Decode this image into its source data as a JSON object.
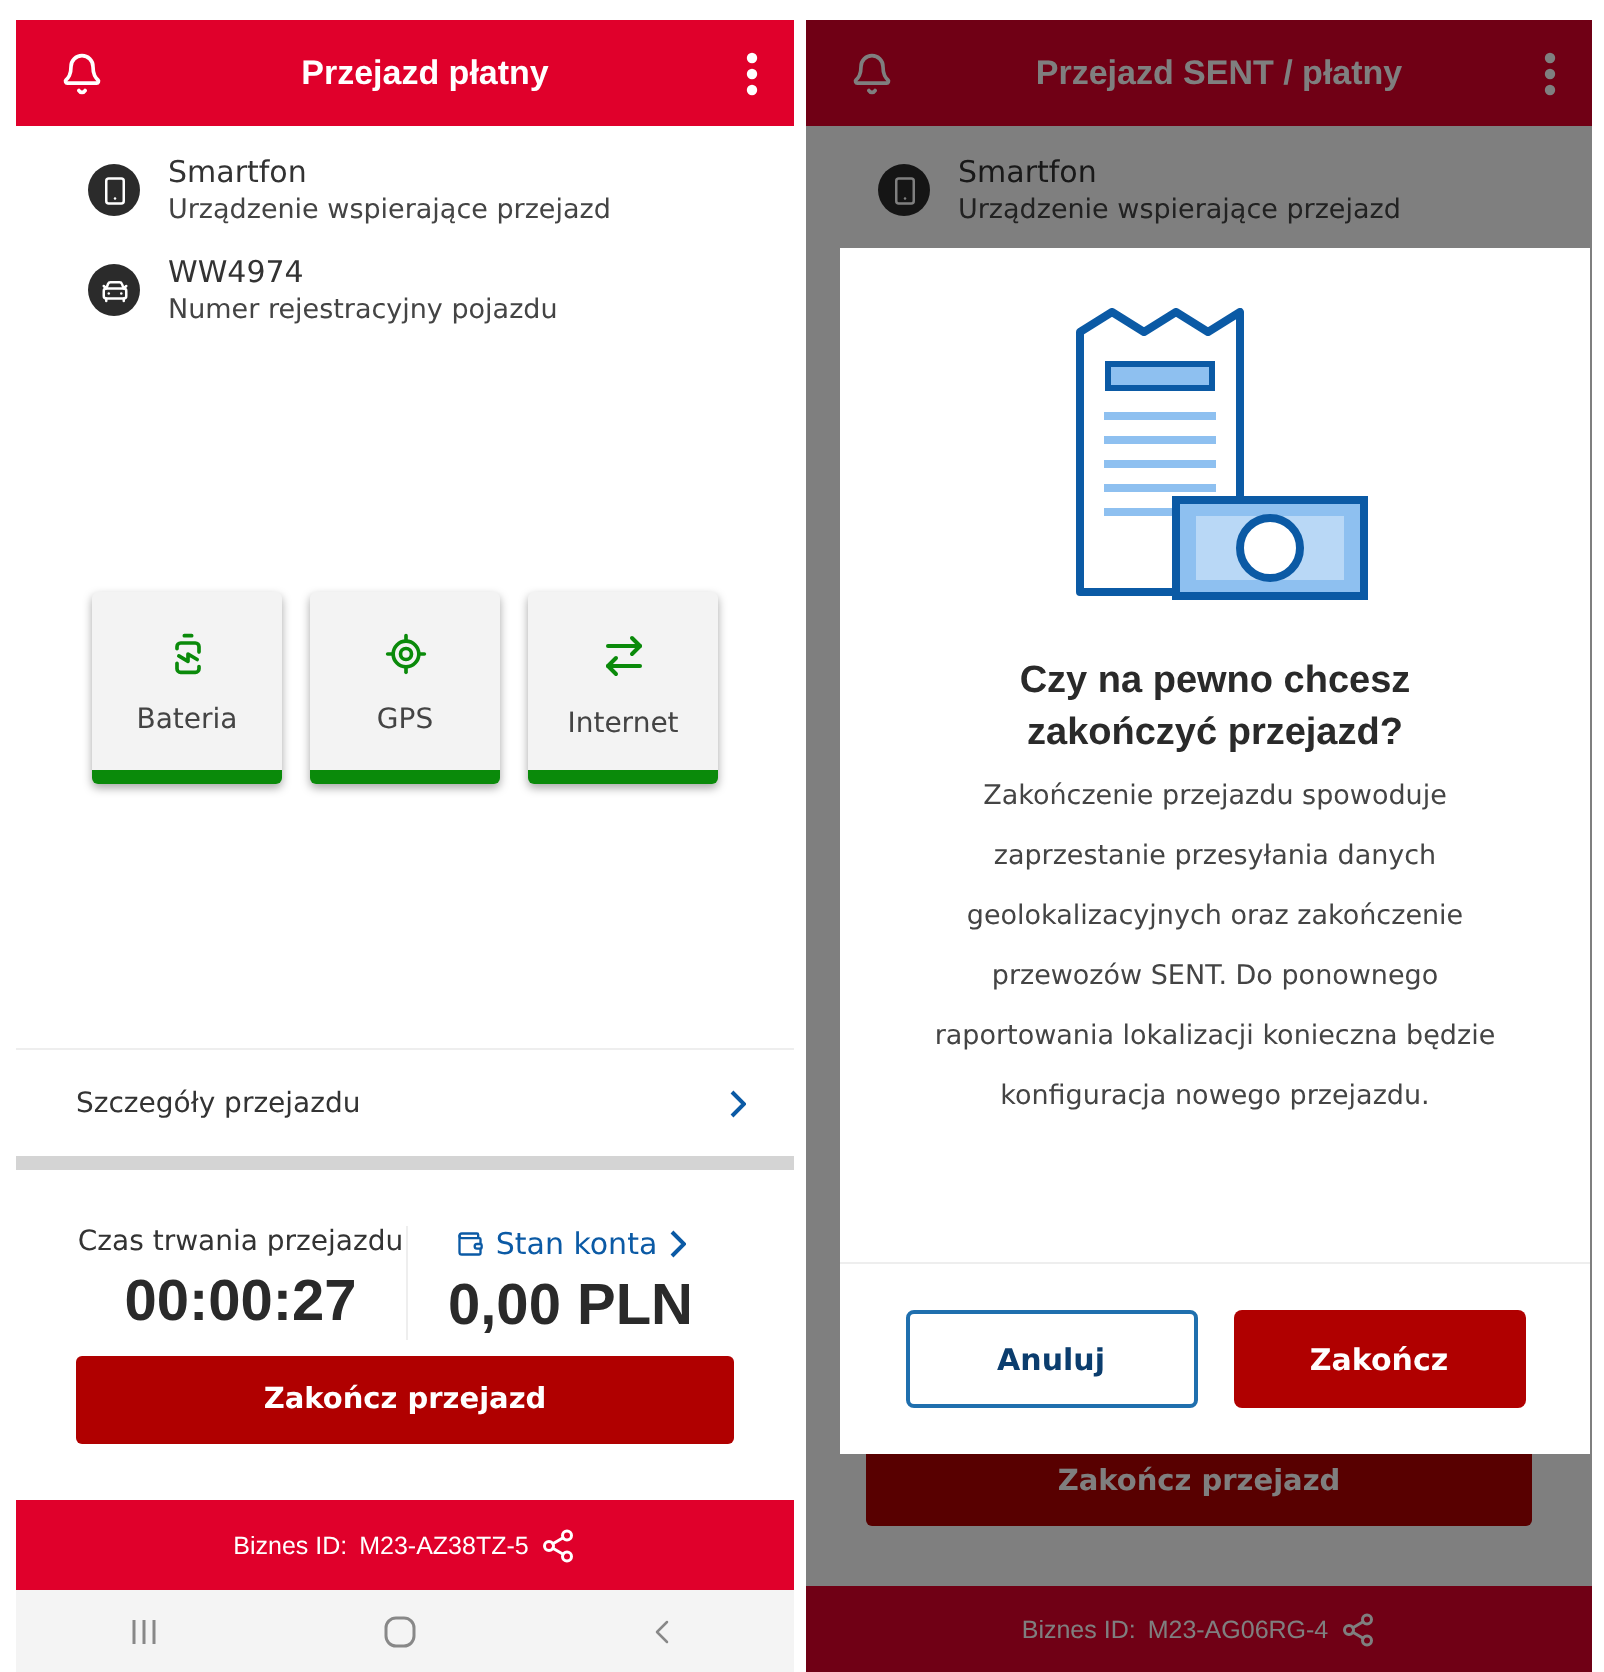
{
  "left_screen": {
    "header": {
      "title": "Przejazd płatny"
    },
    "items": [
      {
        "kind": "phone",
        "name": "Smartfon",
        "description": "Urządzenie wspierające przejazd"
      },
      {
        "kind": "car",
        "name": "WW4974",
        "description": "Numer rejestracyjny pojazdu"
      }
    ],
    "status_tiles": [
      {
        "kind": "battery",
        "label": "Bateria",
        "ok": true
      },
      {
        "kind": "gps",
        "label": "GPS",
        "ok": true
      },
      {
        "kind": "internet",
        "label": "Internet",
        "ok": true
      }
    ],
    "details_link": "Szczegóły przejazdu",
    "duration": {
      "label": "Czas trwania przejazdu",
      "value": "00:00:27"
    },
    "balance": {
      "label": "Stan konta",
      "value": "0,00 PLN"
    },
    "end_button": "Zakończ przejazd",
    "footer": {
      "label": "Biznes ID:",
      "id": "M23-AZ38TZ-5"
    }
  },
  "right_screen": {
    "header": {
      "title": "Przejazd SENT / płatny"
    },
    "items": [
      {
        "kind": "phone",
        "name": "Smartfon",
        "description": "Urządzenie wspierające przejazd"
      }
    ],
    "end_button": "Zakończ przejazd",
    "footer": {
      "label": "Biznes ID:",
      "id": "M23-AG06RG-4"
    },
    "dialog": {
      "title": "Czy na pewno chcesz zakończyć przejazd?",
      "body": "Zakończenie przejazdu spowoduje zaprzestanie przesyłania danych geolokalizacyjnych oraz zakończenie przewozów SENT. Do ponownego raportowania lokalizacji konieczna będzie konfiguracja nowego przejazdu.",
      "buttons": [
        {
          "kind": "secondary",
          "label": "Anuluj"
        },
        {
          "kind": "primary",
          "label": "Zakończ"
        }
      ]
    }
  }
}
